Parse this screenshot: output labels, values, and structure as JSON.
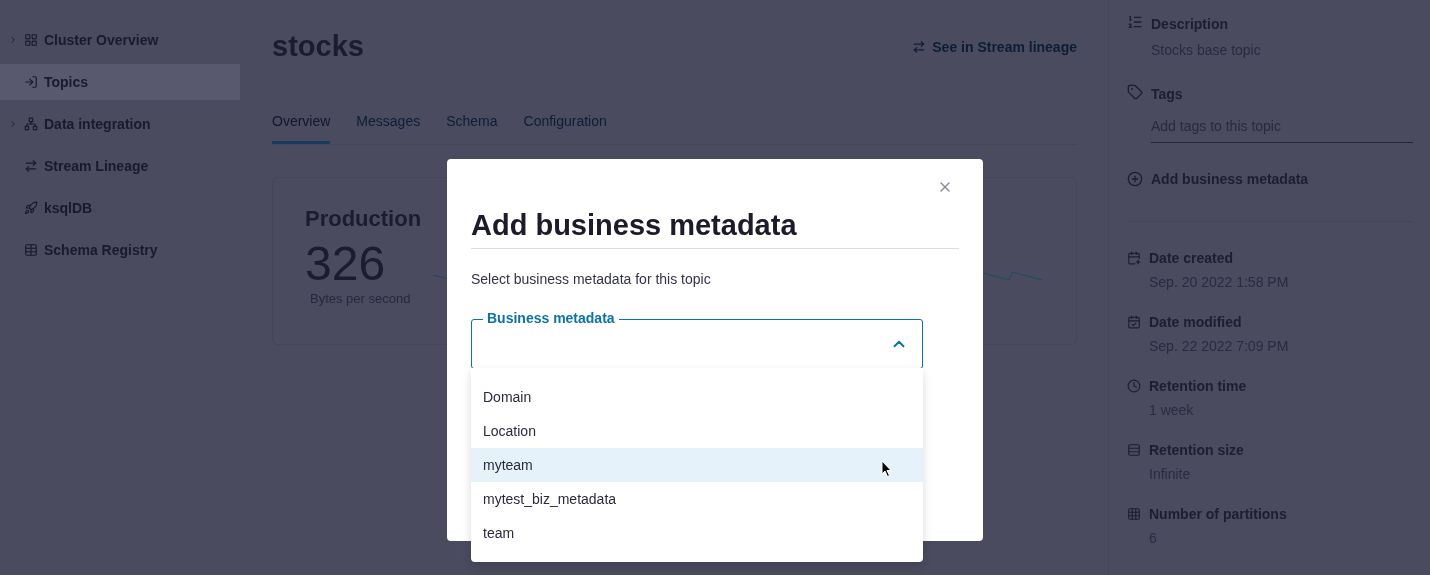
{
  "sidebar": {
    "items": [
      {
        "label": "Cluster Overview",
        "kind": "group",
        "selected": false
      },
      {
        "label": "Topics",
        "kind": "item",
        "selected": true
      },
      {
        "label": "Data integration",
        "kind": "group",
        "selected": false
      },
      {
        "label": "Stream Lineage",
        "kind": "item",
        "selected": false
      },
      {
        "label": "ksqlDB",
        "kind": "item",
        "selected": false
      },
      {
        "label": "Schema Registry",
        "kind": "item",
        "selected": false
      }
    ]
  },
  "page": {
    "title": "stocks",
    "lineage_link": "See in Stream lineage",
    "tabs": [
      {
        "label": "Overview",
        "selected": true
      },
      {
        "label": "Messages",
        "selected": false
      },
      {
        "label": "Schema",
        "selected": false
      },
      {
        "label": "Configuration",
        "selected": false
      }
    ],
    "production_card": {
      "title": "Production",
      "value": "326",
      "unit": "Bytes per second"
    }
  },
  "details": {
    "description_label": "Description",
    "description": "Stocks base topic",
    "tags_label": "Tags",
    "tags_placeholder": "Add tags to this topic",
    "add_metadata": "Add business metadata",
    "properties": [
      {
        "label": "Date created",
        "value": "Sep. 20 2022 1:58 PM"
      },
      {
        "label": "Date modified",
        "value": "Sep. 22 2022 7:09 PM"
      },
      {
        "label": "Retention time",
        "value": "1 week"
      },
      {
        "label": "Retention size",
        "value": "Infinite"
      },
      {
        "label": "Number of partitions",
        "value": "6"
      }
    ]
  },
  "dialog": {
    "title": "Add business metadata",
    "subtitle": "Select business metadata for this topic",
    "field_label": "Business metadata",
    "expanded": true,
    "options": [
      {
        "label": "Domain",
        "selected": false
      },
      {
        "label": "Location",
        "selected": false
      },
      {
        "label": "myteam",
        "selected": true
      },
      {
        "label": "mytest_biz_metadata",
        "selected": false
      },
      {
        "label": "team",
        "selected": false
      }
    ]
  }
}
